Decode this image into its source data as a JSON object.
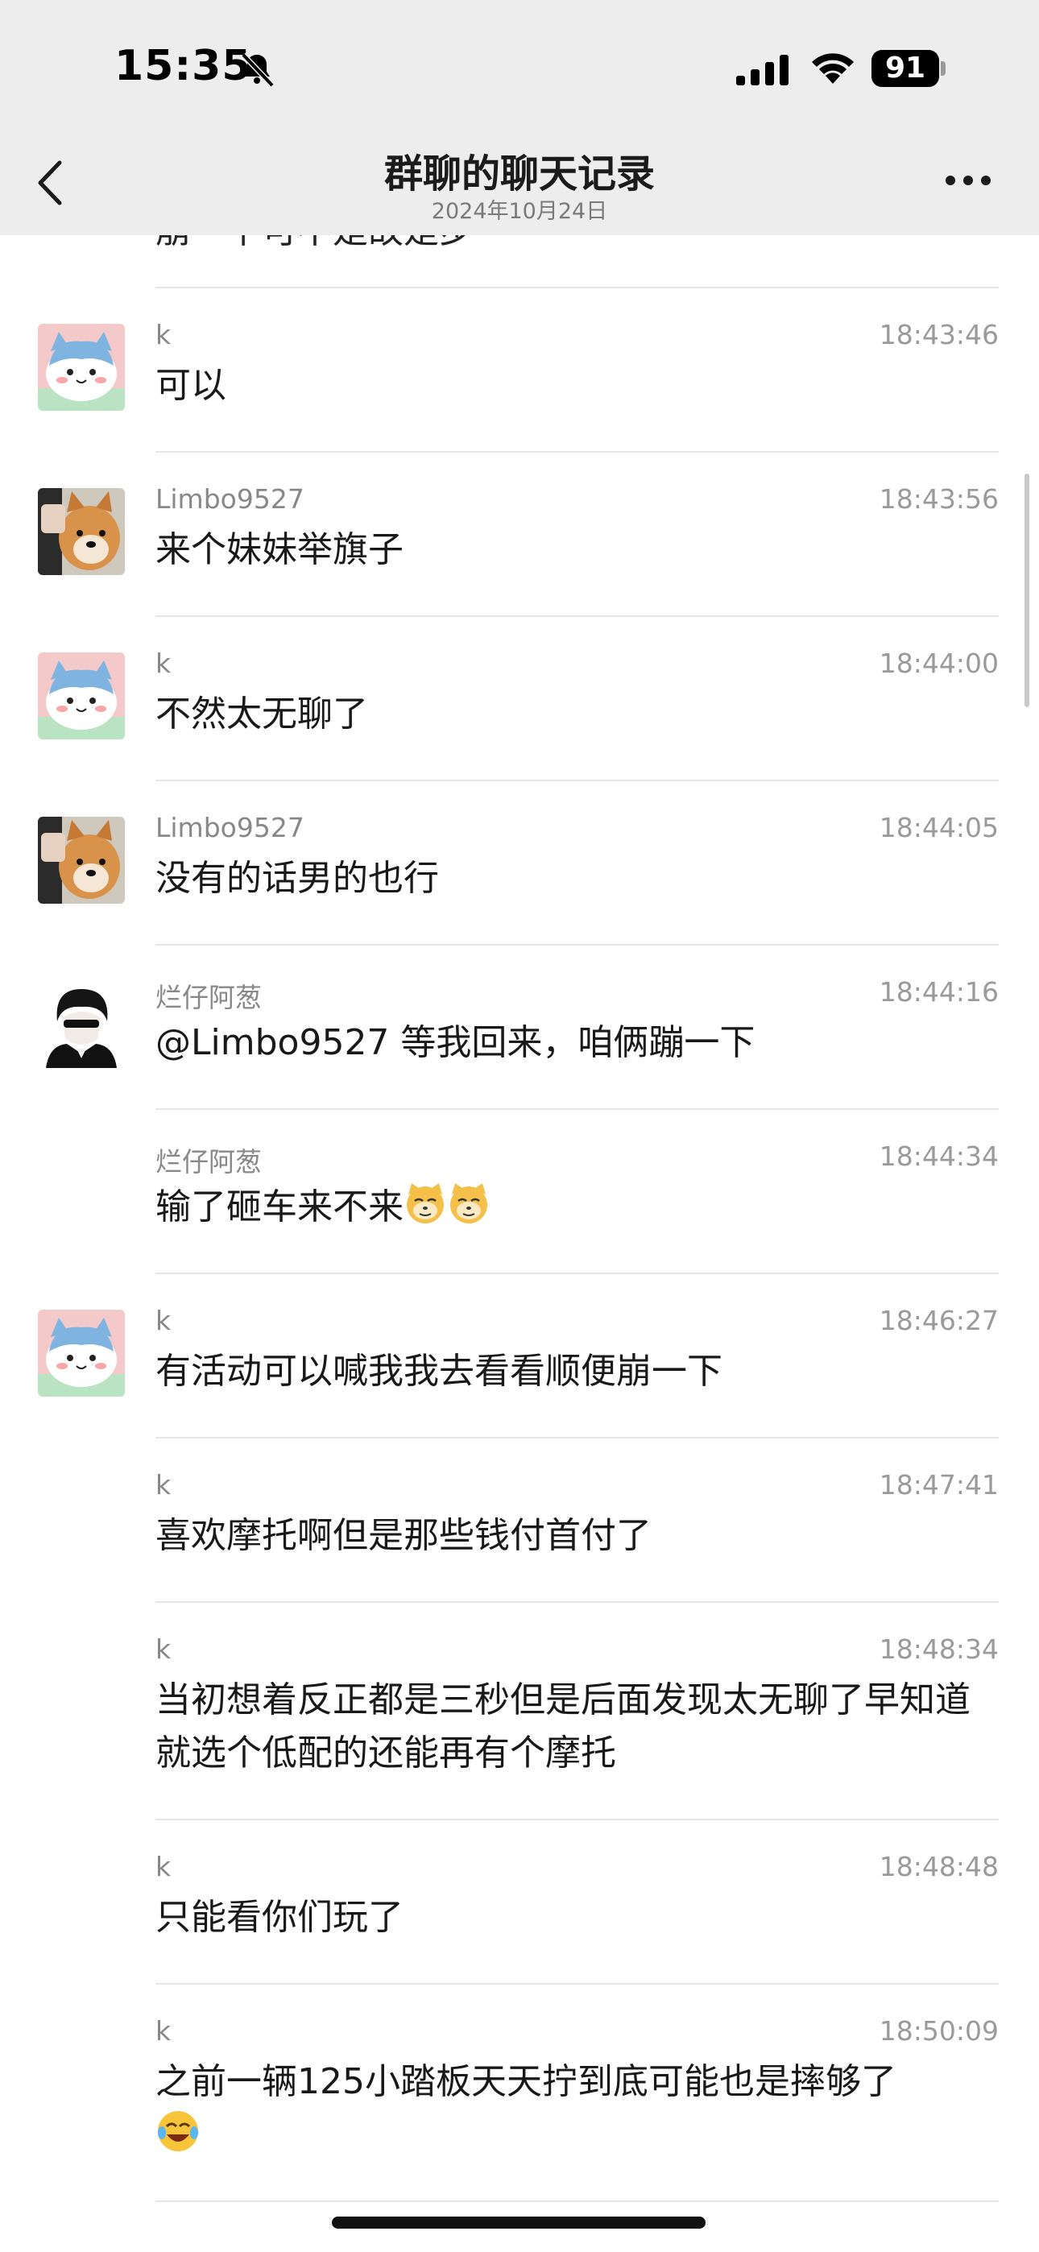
{
  "status": {
    "time": "15:35",
    "battery": "91"
  },
  "nav": {
    "title": "群聊的聊天记录",
    "subtitle": "2024年10月24日"
  },
  "partial_top": "崩一下可不是故是步",
  "messages": [
    {
      "sender": "k",
      "time": "18:43:46",
      "text": "可以",
      "avatar": "hachiware-icon"
    },
    {
      "sender": "Limbo9527",
      "time": "18:43:56",
      "text": "来个妹妹举旗子",
      "avatar": "shiba-dog-icon"
    },
    {
      "sender": "k",
      "time": "18:44:00",
      "text": "不然太无聊了",
      "avatar": "hachiware-icon"
    },
    {
      "sender": "Limbo9527",
      "time": "18:44:05",
      "text": "没有的话男的也行",
      "avatar": "shiba-dog-icon"
    },
    {
      "sender": "烂仔阿葱",
      "time": "18:44:16",
      "text": "@Limbo9527 等我回来，咱俩蹦一下",
      "avatar": "anime-man-icon"
    },
    {
      "sender": "烂仔阿葱",
      "time": "18:44:34",
      "text": "输了砸车来不来",
      "avatar": ""
    },
    {
      "sender": "k",
      "time": "18:46:27",
      "text": "有活动可以喊我我去看看顺便崩一下",
      "avatar": "hachiware-icon"
    },
    {
      "sender": "k",
      "time": "18:47:41",
      "text": "喜欢摩托啊但是那些钱付首付了",
      "avatar": ""
    },
    {
      "sender": "k",
      "time": "18:48:34",
      "text": "当初想着反正都是三秒但是后面发现太无聊了早知道就选个低配的还能再有个摩托",
      "avatar": ""
    },
    {
      "sender": "k",
      "time": "18:48:48",
      "text": "只能看你们玩了",
      "avatar": ""
    },
    {
      "sender": "k",
      "time": "18:50:09",
      "text": "之前一辆125小踏板天天拧到底可能也是摔够了",
      "avatar": ""
    }
  ],
  "icons": {
    "mute": "bell-slash-icon",
    "signal": "cellular-signal-icon",
    "wifi": "wifi-icon",
    "back": "chevron-left-icon",
    "more": "more-dots-icon",
    "cat_emoji": "doge-cat-emoji",
    "laugh_emoji": "tears-of-joy-emoji"
  },
  "colors": {
    "nav_bg": "#ededed",
    "divider": "#e6e6e6",
    "meta": "#9a9a9a"
  }
}
